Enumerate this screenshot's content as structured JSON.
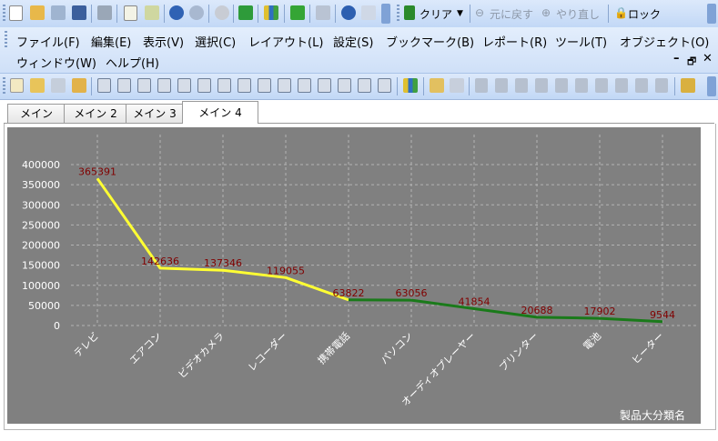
{
  "toolbar_top": {
    "clear_label": "クリア",
    "undo_label": "元に戻す",
    "redo_label": "やり直し",
    "lock_label": "ロック"
  },
  "menu": {
    "items": [
      "ファイル(F)",
      "編集(E)",
      "表示(V)",
      "選択(C)",
      "レイアウト(L)",
      "設定(S)",
      "ブックマーク(B)",
      "レポート(R)",
      "ツール(T)",
      "オブジェクト(O)"
    ],
    "items2": [
      "ウィンドウ(W)",
      "ヘルプ(H)"
    ]
  },
  "tabs": [
    "メイン",
    "メイン 2",
    "メイン 3",
    "メイン 4"
  ],
  "active_tab": 3,
  "colors": {
    "chart_bg": "#808080",
    "line_high": "#ffff33",
    "line_low": "#1a7a1a",
    "label": "#800000",
    "text": "#ffffff"
  },
  "chart_data": {
    "type": "line",
    "categories": [
      "テレビ",
      "エアコン",
      "ビデオカメラ",
      "レコーダー",
      "携帯電話",
      "パソコン",
      "オーディオプレーヤー",
      "プリンター",
      "電池",
      "ヒーター"
    ],
    "values": [
      365391,
      142636,
      137346,
      119055,
      63822,
      63056,
      41854,
      20688,
      17902,
      9544
    ],
    "y_ticks": [
      0,
      50000,
      100000,
      150000,
      200000,
      250000,
      300000,
      350000,
      400000
    ],
    "ylim": [
      0,
      400000
    ],
    "xlabel": "製品大分類名",
    "grid": true
  }
}
